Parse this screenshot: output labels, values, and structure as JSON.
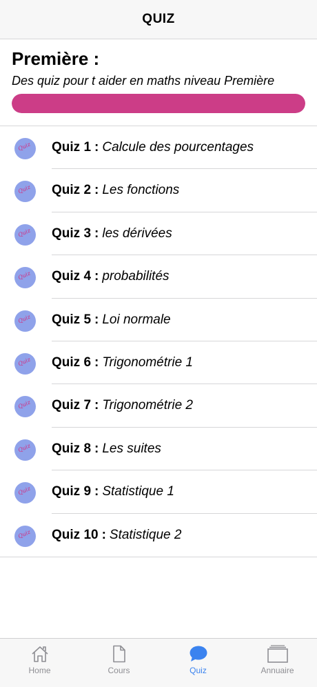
{
  "navbar": {
    "title": "QUIZ"
  },
  "header": {
    "title": "Première :",
    "subtitle": "Des quiz pour t aider en maths niveau Première",
    "progress_percent": 100,
    "progress_color": "#cc3d87"
  },
  "quiz_icon": {
    "label": "Quiz",
    "circle_color": "#8fa2ea",
    "text_color": "#d23080"
  },
  "quizzes": [
    {
      "number": "Quiz 1",
      "separator": ":",
      "topic": "Calcule des pourcentages"
    },
    {
      "number": "Quiz 2",
      "separator": ":",
      "topic": "Les fonctions"
    },
    {
      "number": "Quiz 3",
      "separator": ":",
      "topic": "les dérivées"
    },
    {
      "number": "Quiz 4",
      "separator": ":",
      "topic": "probabilités"
    },
    {
      "number": "Quiz 5",
      "separator": ":",
      "topic": "Loi normale"
    },
    {
      "number": "Quiz 6",
      "separator": ":",
      "topic": "Trigonométrie 1"
    },
    {
      "number": "Quiz 7",
      "separator": ":",
      "topic": "Trigonométrie 2"
    },
    {
      "number": "Quiz 8",
      "separator": ":",
      "topic": "Les suites"
    },
    {
      "number": "Quiz 9",
      "separator": ":",
      "topic": "Statistique 1"
    },
    {
      "number": "Quiz 10",
      "separator": ":",
      "topic": "Statistique 2"
    }
  ],
  "tabbar": {
    "active_color": "#3b83ef",
    "inactive_color": "#8e8e93",
    "tabs": [
      {
        "label": "Home",
        "icon": "home-icon",
        "active": false
      },
      {
        "label": "Cours",
        "icon": "document-icon",
        "active": false
      },
      {
        "label": "Quiz",
        "icon": "speech-bubble-icon",
        "active": true
      },
      {
        "label": "Annuaire",
        "icon": "stacked-cards-icon",
        "active": false
      }
    ]
  }
}
